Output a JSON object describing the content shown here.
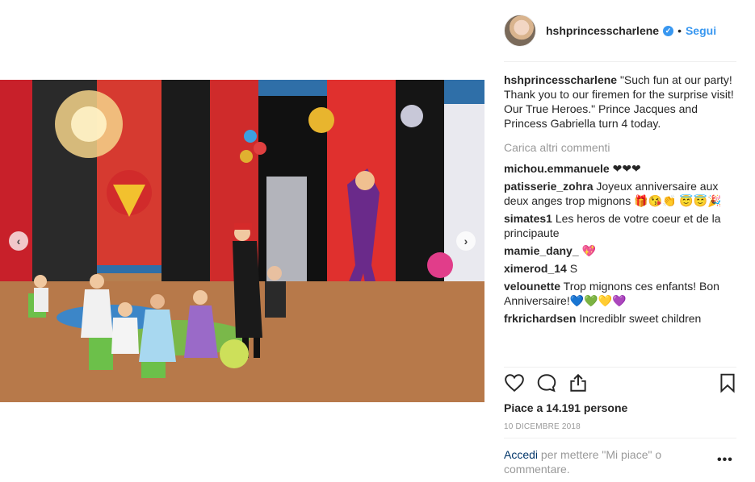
{
  "post": {
    "username": "hshprincesscharlene",
    "verified_mark": "✓",
    "separator": "•",
    "follow_label": "Segui",
    "caption_text": "\"Such fun at our party! Thank you to our firemen for the surprise visit!\nOur True Heroes.\" Prince Jacques and Princess Gabriella turn 4 today."
  },
  "comments": {
    "load_more_label": "Carica altri commenti",
    "items": [
      {
        "user": "michou.emmanuele",
        "text": "❤❤❤"
      },
      {
        "user": "patisserie_zohra",
        "text": "Joyeux anniversaire aux deux anges trop mignons 🎁😘👏 😇😇🎉"
      },
      {
        "user": "simates1",
        "text": "Les heros de votre coeur et de la principaute"
      },
      {
        "user": "mamie_dany_",
        "text": "💖"
      },
      {
        "user": "ximerod_14",
        "text": "S"
      },
      {
        "user": "velounette",
        "text": "Trop mignons ces enfants! Bon Anniversaire!💙💚💛💜"
      },
      {
        "user": "frkrichardsen",
        "text": "Incrediblr sweet children"
      }
    ]
  },
  "actions": {
    "like_icon": "heart-icon",
    "comment_icon": "comment-icon",
    "share_icon": "share-icon",
    "save_icon": "bookmark-icon"
  },
  "stats": {
    "likes_label": "Piace a 14.191 persone",
    "date_label": "10 DICEMBRE 2018"
  },
  "footer": {
    "login_link": "Accedi",
    "login_text": " per mettere \"Mi piace\" o commentare.",
    "more_label": "•••"
  },
  "carousel": {
    "prev_label": "‹",
    "next_label": "›"
  },
  "colors": {
    "accent": "#3897f0",
    "text": "#262626",
    "muted": "#999999",
    "link_dark": "#003569"
  }
}
